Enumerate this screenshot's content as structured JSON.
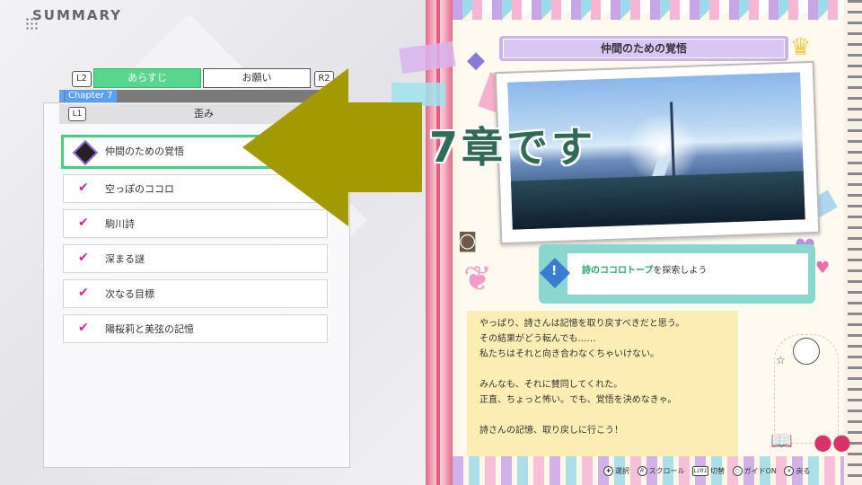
{
  "header": {
    "title": "SUMMARY"
  },
  "tabs": {
    "left_trigger": "L2",
    "right_trigger": "R2",
    "items": [
      {
        "label": "あらすじ",
        "active": true
      },
      {
        "label": "お願い",
        "active": false
      }
    ]
  },
  "chapter": {
    "label": "Chapter 7",
    "name_trigger": "L1",
    "name": "歪み"
  },
  "list": {
    "items": [
      {
        "label": "仲間のための覚悟",
        "status": "current"
      },
      {
        "label": "空っぽのココロ",
        "status": "done"
      },
      {
        "label": "駒川詩",
        "status": "done"
      },
      {
        "label": "深まる謎",
        "status": "done"
      },
      {
        "label": "次なる目標",
        "status": "done"
      },
      {
        "label": "陽桜莉と美弦の記憶",
        "status": "done"
      }
    ],
    "check_glyph": "✔"
  },
  "overlay": {
    "text": "7章です",
    "arrow_color": "#a29a00",
    "text_color": "#2f6b56"
  },
  "detail": {
    "title": "仲間のための覚悟",
    "objective_mark": "!",
    "objective_highlight": "詩のココロトープ",
    "objective_rest": "を探索しよう",
    "story": "やっぱり、詩さんは記憶を取り戻すべきだと思う。\nその結果がどう転んでも……\n私たちはそれと向き合わなくちゃいけない。\n\nみんなも、それに賛同してくれた。\n正直、ちょっと怖い。でも、覚悟を決めなきゃ。\n\n詩さんの記憶、取り戻しに行こう！"
  },
  "footer": {
    "guide": [
      {
        "icon": "✚",
        "label": "選択"
      },
      {
        "icon": "R",
        "label": "スクロール"
      },
      {
        "icon": "L1R1",
        "label": "切替"
      },
      {
        "icon": "○",
        "label": "ガイドON"
      },
      {
        "icon": "✕",
        "label": "戻る"
      }
    ]
  },
  "colors": {
    "accent_green": "#58d68d",
    "check_pink": "#e0209a",
    "binding_pink": "#e06a8c",
    "note_yellow": "#fbedb4",
    "objective_teal": "#8ad7d0"
  }
}
